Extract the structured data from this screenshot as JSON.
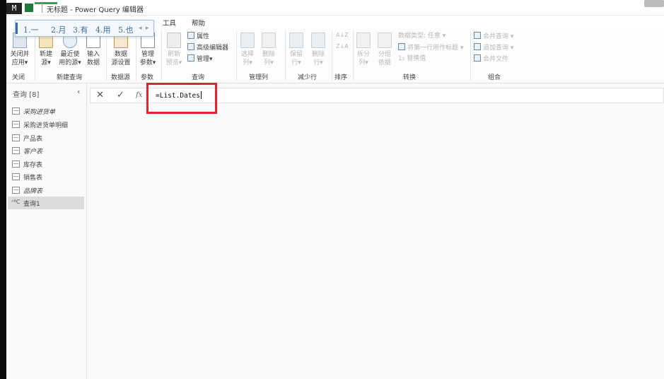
{
  "titlebar": {
    "title": "无标题 - Power Query 编辑器",
    "app_icon": "M"
  },
  "menu": {
    "tabs": [
      "工具",
      "帮助"
    ]
  },
  "ime_candidates": {
    "items": [
      "1.一",
      "2.月",
      "3.有",
      "4.用",
      "5.也"
    ]
  },
  "ribbon": {
    "close": {
      "buttons": [
        {
          "label1": "关闭并",
          "label2": "应用",
          "has_arrow": true
        }
      ],
      "group_label": "关闭"
    },
    "new_query": {
      "buttons": [
        {
          "label1": "新建",
          "label2": "源",
          "has_arrow": true
        },
        {
          "label1": "最近使",
          "label2": "用的源",
          "has_arrow": true
        },
        {
          "label1": "输入",
          "label2": "数据",
          "has_arrow": false
        }
      ],
      "group_label": "新建查询"
    },
    "data_source": {
      "buttons": [
        {
          "label1": "数据",
          "label2": "源设置"
        }
      ],
      "group_label": "数据源"
    },
    "params": {
      "buttons": [
        {
          "label1": "管理",
          "label2": "参数",
          "has_arrow": true
        }
      ],
      "group_label": "参数"
    },
    "query": {
      "big": {
        "label1": "刷新",
        "label2": "预览",
        "has_arrow": true
      },
      "small": [
        {
          "label": "属性"
        },
        {
          "label": "高级编辑器"
        },
        {
          "label": "管理",
          "has_arrow": true
        }
      ],
      "group_label": "查询"
    },
    "manage_cols": {
      "buttons": [
        {
          "label1": "选择",
          "label2": "列",
          "has_arrow": true
        },
        {
          "label1": "删除",
          "label2": "列",
          "has_arrow": true
        }
      ],
      "group_label": "管理列"
    },
    "reduce_rows": {
      "buttons": [
        {
          "label1": "保留",
          "label2": "行",
          "has_arrow": true
        },
        {
          "label1": "删除",
          "label2": "行",
          "has_arrow": true
        }
      ],
      "group_label": "减少行"
    },
    "sort": {
      "group_label": "排序"
    },
    "transform": {
      "buttons": [
        {
          "label1": "拆分",
          "label2": "列",
          "has_arrow": true
        },
        {
          "label1": "分组",
          "label2": "依据",
          "has_arrow": false
        }
      ],
      "small": [
        {
          "label": "数据类型: 任意",
          "has_arrow": true
        },
        {
          "label": "将第一行用作标题",
          "has_arrow": true
        },
        {
          "label": "替换值",
          "prefix": "1₂"
        }
      ],
      "group_label": "转换"
    },
    "combine": {
      "small": [
        {
          "label": "合并查询",
          "has_arrow": true
        },
        {
          "label": "追加查询",
          "has_arrow": true
        },
        {
          "label": "合并文件"
        }
      ],
      "group_label": "组合"
    }
  },
  "sidebar": {
    "header": "查询 [8]",
    "queries": [
      {
        "name": "采购进货单",
        "italic": true,
        "type": "table"
      },
      {
        "name": "采购进货单明细",
        "italic": false,
        "type": "table"
      },
      {
        "name": "产品表",
        "italic": false,
        "type": "table"
      },
      {
        "name": "客户表",
        "italic": true,
        "type": "table"
      },
      {
        "name": "库存表",
        "italic": false,
        "type": "table"
      },
      {
        "name": "销售表",
        "italic": false,
        "type": "table"
      },
      {
        "name": "品牌表",
        "italic": true,
        "type": "table"
      },
      {
        "name": "查询1",
        "italic": false,
        "type": "abc",
        "selected": true
      }
    ]
  },
  "formula_bar": {
    "cancel_icon": "✕",
    "confirm_icon": "✓",
    "fx_label": "fx",
    "formula": "=List.Dates"
  },
  "colors": {
    "highlight": "#e4242b",
    "selected_bg": "#dcdcdc",
    "ime_text": "#3a6ea5"
  }
}
